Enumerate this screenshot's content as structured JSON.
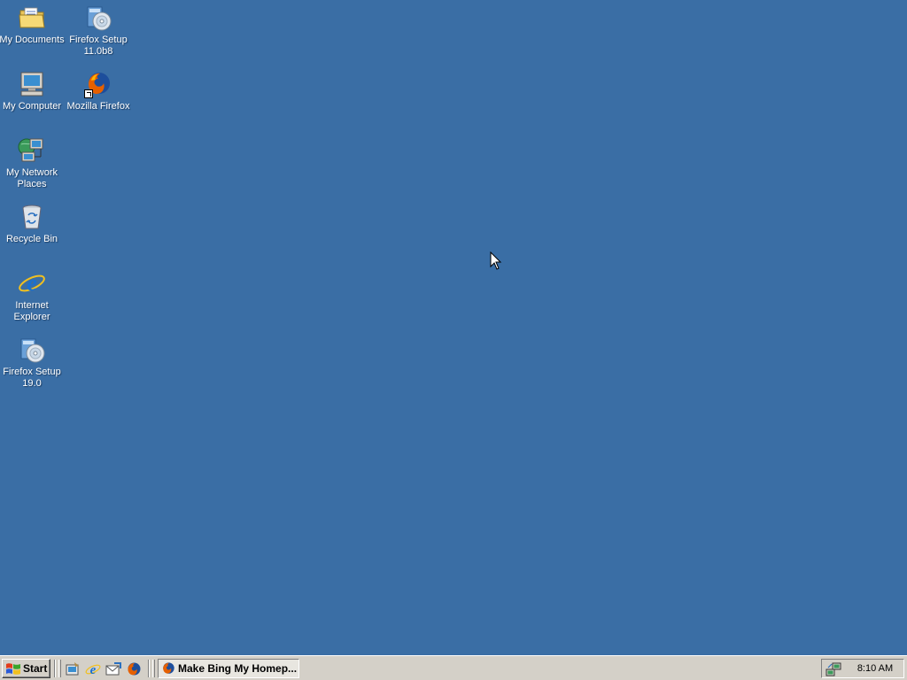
{
  "desktop": {
    "background_color": "#3a6ea5",
    "icons": [
      {
        "label": "My Documents",
        "icon": "folder-documents-icon"
      },
      {
        "label": "Firefox Setup 11.0b8",
        "icon": "installer-cd-icon"
      },
      {
        "label": "My Computer",
        "icon": "computer-icon"
      },
      {
        "label": "Mozilla Firefox",
        "icon": "firefox-icon"
      },
      {
        "label": "My Network Places",
        "icon": "network-places-icon"
      },
      {
        "label": "Recycle Bin",
        "icon": "recycle-bin-icon"
      },
      {
        "label": "Internet Explorer",
        "icon": "internet-explorer-icon"
      },
      {
        "label": "Firefox Setup 19.0",
        "icon": "installer-cd-icon"
      }
    ]
  },
  "taskbar": {
    "start_label": "Start",
    "quick_launch": [
      {
        "icon": "show-desktop-icon"
      },
      {
        "icon": "internet-explorer-icon"
      },
      {
        "icon": "outlook-express-icon"
      },
      {
        "icon": "firefox-icon"
      }
    ],
    "active_task": {
      "label": "Make Bing My Homep...",
      "icon": "firefox-icon"
    },
    "tray": {
      "icon": "network-connection-icon",
      "clock": "8:10 AM"
    }
  }
}
